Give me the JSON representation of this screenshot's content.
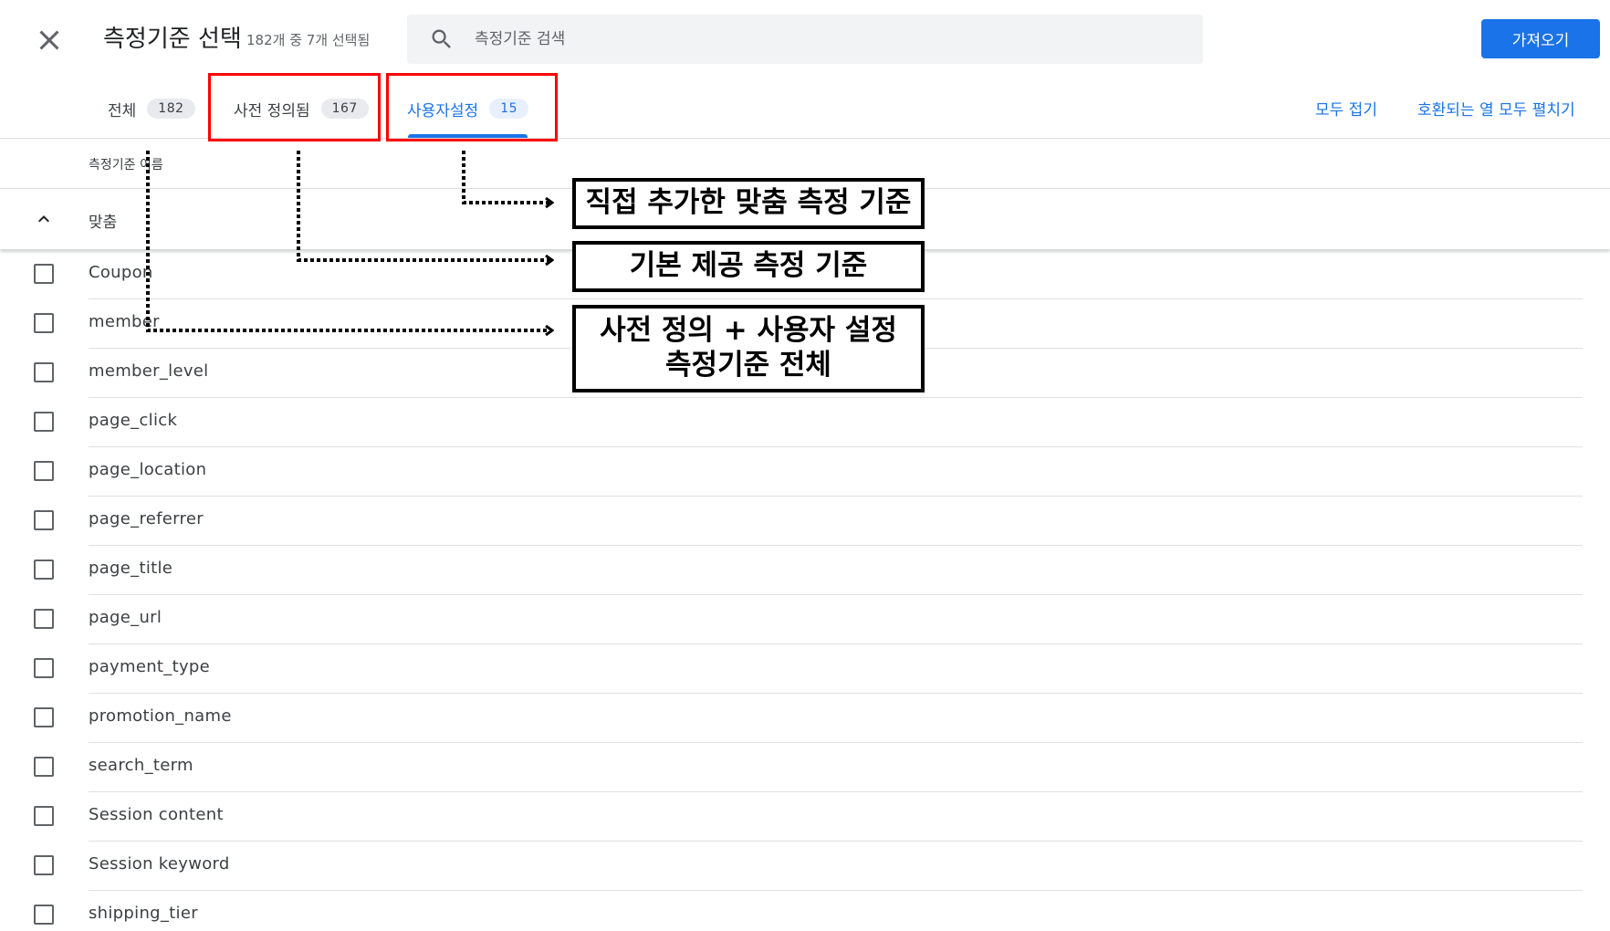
{
  "header": {
    "title": "측정기준 선택",
    "subtitle": "182개 중 7개 선택됨",
    "search_placeholder": "측정기준 검색",
    "import_label": "가져오기"
  },
  "tabs": [
    {
      "label": "전체",
      "count": "182",
      "active": false
    },
    {
      "label": "사전 정의됨",
      "count": "167",
      "active": false
    },
    {
      "label": "사용자설정",
      "count": "15",
      "active": true
    }
  ],
  "actions": {
    "collapse_all": "모두 접기",
    "expand_all": "호환되는 열 모두 펼치기"
  },
  "table": {
    "column_header": "측정기준 이름",
    "group": {
      "label": "맞춤",
      "expanded": true
    },
    "rows": [
      {
        "label": "Coupon",
        "checked": false
      },
      {
        "label": "member",
        "checked": false
      },
      {
        "label": "member_level",
        "checked": false
      },
      {
        "label": "page_click",
        "checked": false
      },
      {
        "label": "page_location",
        "checked": false
      },
      {
        "label": "page_referrer",
        "checked": false
      },
      {
        "label": "page_title",
        "checked": false
      },
      {
        "label": "page_url",
        "checked": false
      },
      {
        "label": "payment_type",
        "checked": false
      },
      {
        "label": "promotion_name",
        "checked": false
      },
      {
        "label": "search_term",
        "checked": false
      },
      {
        "label": "Session content",
        "checked": false
      },
      {
        "label": "Session keyword",
        "checked": false
      },
      {
        "label": "shipping_tier",
        "checked": false
      }
    ]
  },
  "annotations": {
    "custom_note": "직접 추가한 맞춤 측정 기준",
    "predefined_note": "기본 제공 측정 기준",
    "all_note_line1": "사전 정의 + 사용자 설정",
    "all_note_line2": "측정기준 전체",
    "highlight_color": "#ff0000"
  },
  "colors": {
    "accent": "#1a73e8",
    "text": "#3c4043",
    "search_bg": "#f1f3f4"
  }
}
